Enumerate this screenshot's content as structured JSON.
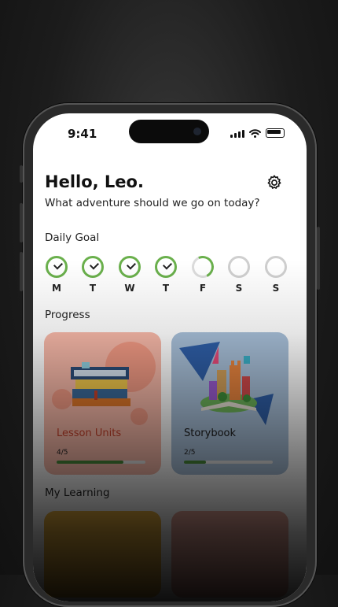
{
  "status_bar": {
    "time": "9:41"
  },
  "header": {
    "greeting": "Hello, Leo.",
    "subtitle": "What adventure should we go on today?"
  },
  "daily_goal": {
    "title": "Daily Goal",
    "days": [
      {
        "label": "M",
        "state": "done"
      },
      {
        "label": "T",
        "state": "done"
      },
      {
        "label": "W",
        "state": "done"
      },
      {
        "label": "T",
        "state": "done"
      },
      {
        "label": "F",
        "state": "partial"
      },
      {
        "label": "S",
        "state": "empty"
      },
      {
        "label": "S",
        "state": "empty"
      }
    ]
  },
  "progress": {
    "title": "Progress",
    "cards": [
      {
        "title": "Lesson Units",
        "count": "4/5",
        "progress": 0.75
      },
      {
        "title": "Storybook",
        "count": "2/5",
        "progress": 0.25
      }
    ]
  },
  "my_learning": {
    "title": "My Learning"
  },
  "colors": {
    "accent_green": "#6ab04c",
    "progress_green": "#4a8c3a",
    "lesson_card_bg": "#f7b8a8",
    "storybook_card_bg": "#a7bfd8",
    "lesson_title": "#c8412a"
  }
}
